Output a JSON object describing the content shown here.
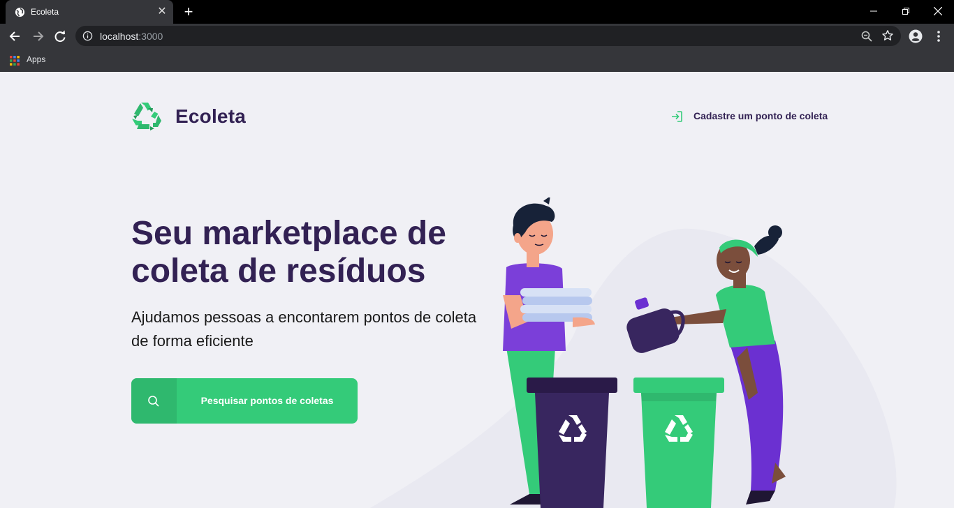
{
  "browser": {
    "tab_title": "Ecoleta",
    "url_host": "localhost",
    "url_port": ":3000",
    "bookmarks_apps_label": "Apps",
    "new_tab_symbol": "+",
    "close_symbol": "✕",
    "icons": [
      "globe-icon",
      "back-arrow-icon",
      "forward-arrow-icon",
      "reload-icon",
      "info-icon",
      "zoom-out-icon",
      "star-icon",
      "profile-icon",
      "kebab-menu-icon",
      "apps-grid-icon"
    ]
  },
  "header": {
    "logo_text": "Ecoleta",
    "register_label": "Cadastre um ponto de coleta"
  },
  "hero": {
    "title_line1": "Seu marketplace de",
    "title_line2": "coleta de resíduos",
    "subtitle_line1": "Ajudamos pessoas a encontarem pontos de coleta",
    "subtitle_line2": "de forma eficiente",
    "search_button_label": "Pesquisar pontos de coletas"
  },
  "colors": {
    "primary_green": "#34cb79",
    "dark_purple": "#322153",
    "background": "#f0f0f5"
  }
}
